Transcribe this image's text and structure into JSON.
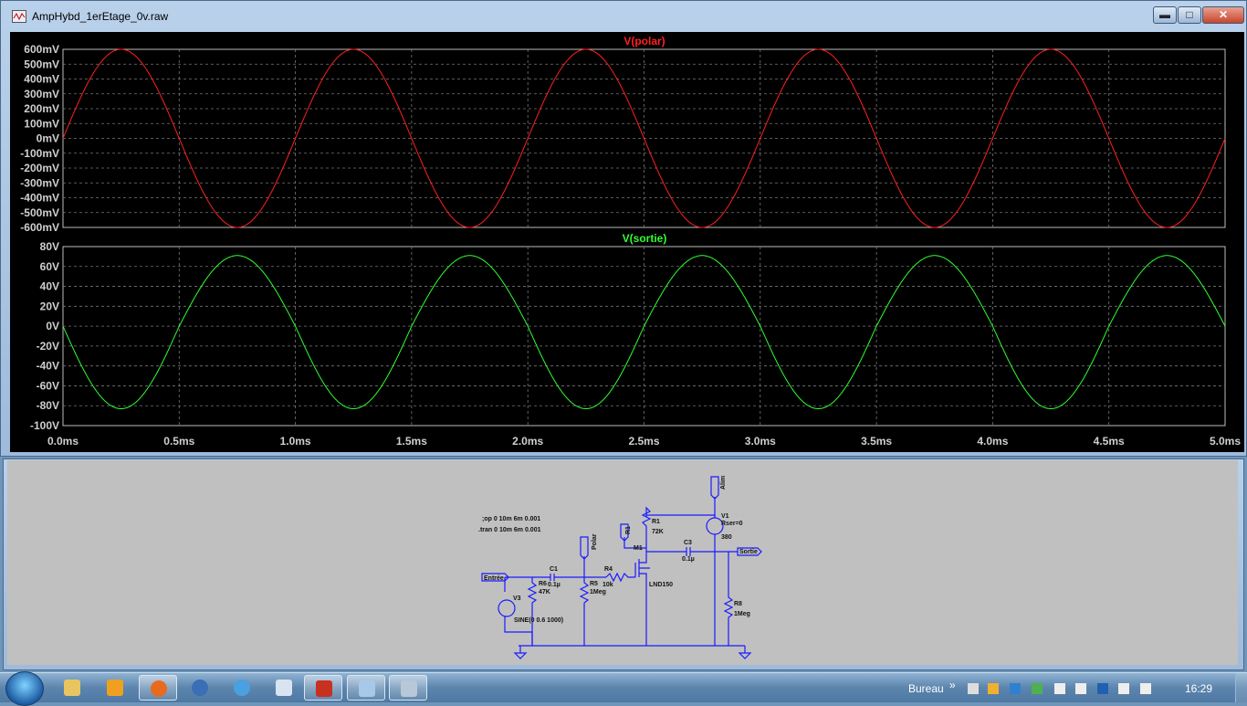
{
  "window_top": {
    "title": "AmpHybd_1erEtage_0v.raw",
    "buttons": {
      "minimize": "▬",
      "maximize": "□",
      "close": "✕"
    }
  },
  "chart_data": [
    {
      "type": "line",
      "title": "V(polar)",
      "color": "#ff2020",
      "x_unit": "ms",
      "xlim": [
        0,
        5
      ],
      "ylim": [
        -600,
        600
      ],
      "y_unit": "mV",
      "y_ticks": [
        "600mV",
        "500mV",
        "400mV",
        "300mV",
        "200mV",
        "100mV",
        "0mV",
        "-100mV",
        "-200mV",
        "-300mV",
        "-400mV",
        "-500mV",
        "-600mV"
      ],
      "y_tick_values": [
        600,
        500,
        400,
        300,
        200,
        100,
        0,
        -100,
        -200,
        -300,
        -400,
        -500,
        -600
      ],
      "series": [
        {
          "name": "V(polar)",
          "amplitude": 600,
          "offset": 0,
          "frequency_khz": 1,
          "phase": "sine"
        }
      ],
      "grid": true
    },
    {
      "type": "line",
      "title": "V(sortie)",
      "color": "#30ff30",
      "x_unit": "ms",
      "xlim": [
        0,
        5
      ],
      "ylim": [
        -100,
        80
      ],
      "y_unit": "V",
      "y_ticks": [
        "80V",
        "60V",
        "40V",
        "20V",
        "0V",
        "-20V",
        "-40V",
        "-60V",
        "-80V",
        "-100V"
      ],
      "y_tick_values": [
        80,
        60,
        40,
        20,
        0,
        -20,
        -40,
        -60,
        -80,
        -100
      ],
      "series": [
        {
          "name": "V(sortie)",
          "amplitude_pos": 71,
          "amplitude_neg": -83,
          "frequency_khz": 1,
          "phase": "inverted"
        }
      ],
      "x_ticks": [
        "0.0ms",
        "0.5ms",
        "1.0ms",
        "1.5ms",
        "2.0ms",
        "2.5ms",
        "3.0ms",
        "3.5ms",
        "4.0ms",
        "4.5ms",
        "5.0ms"
      ],
      "x_tick_values": [
        0,
        0.5,
        1,
        1.5,
        2,
        2.5,
        3,
        3.5,
        4,
        4.5,
        5
      ],
      "grid": true
    }
  ],
  "schematic": {
    "directives": [
      ";op 0 10m 6m 0.001",
      ".tran 0 10m 6m 0.001"
    ],
    "labels": {
      "entree": "Entrée",
      "polar": "Polar",
      "sortie": "Sortie",
      "alim": "Alim",
      "r1flag": "R1",
      "c1": "C1",
      "c1v": "0.1µ",
      "r6": "R6",
      "r6v": "47K",
      "r5": "R5",
      "r5v": "1Meg",
      "r4": "R4",
      "r4v": "10k",
      "m1": "M1",
      "m1v": "LND150",
      "r1": "R1",
      "r1v": "72K",
      "c3": "C3",
      "c3v": "0.1µ",
      "v1": "V1",
      "v1a": "Rser=0",
      "v1v": "380",
      "r8": "R8",
      "r8v": "1Meg",
      "v3": "V3",
      "v3v": "SINE(0 0.6 1000)"
    }
  },
  "taskbar": {
    "tray_label": "Bureau",
    "chevron": "»",
    "clock": "16:29"
  }
}
